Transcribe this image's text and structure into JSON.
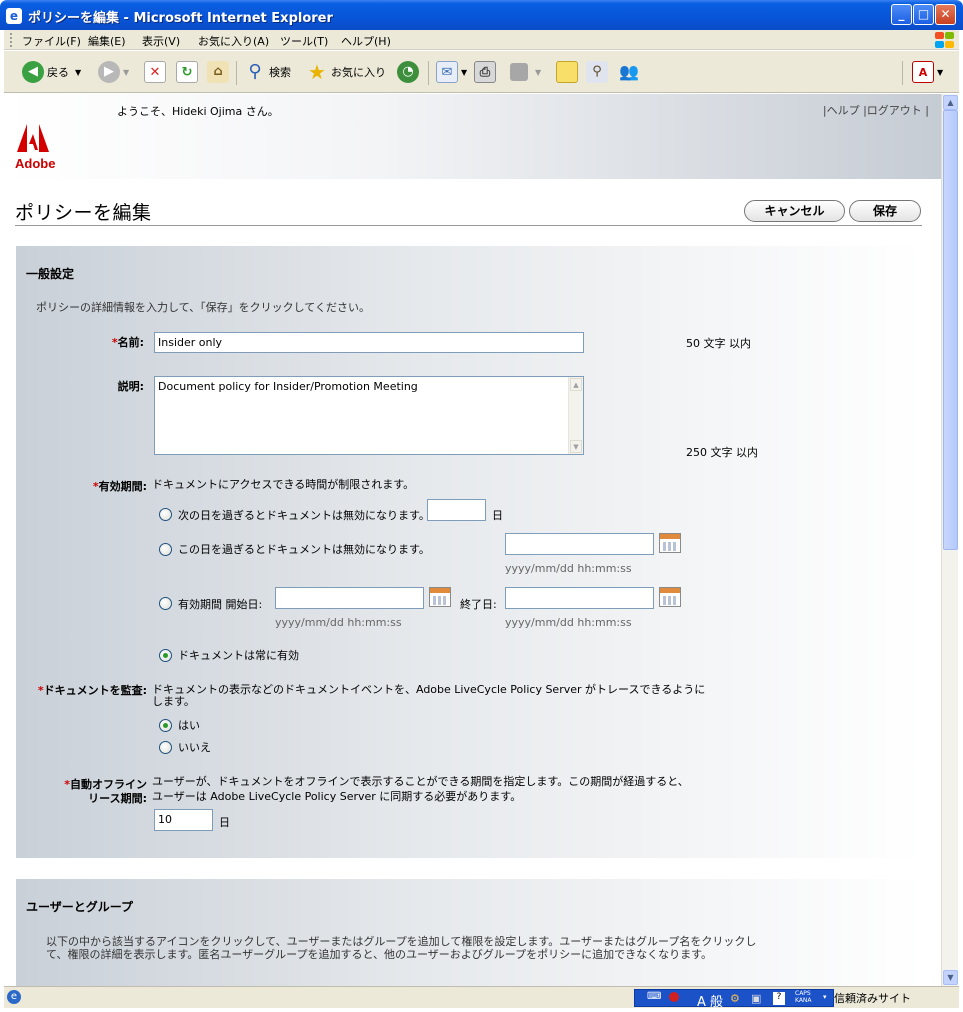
{
  "window": {
    "title": "ポリシーを編集 - Microsoft Internet Explorer",
    "ie_icon": "e",
    "min": "_",
    "max": "□",
    "close": "✕"
  },
  "menu": [
    "ファイル(F)",
    "編集(E)",
    "表示(V)",
    "お気に入り(A)",
    "ツール(T)",
    "ヘルプ(H)"
  ],
  "toolbar": {
    "back": "戻る",
    "search": "検索",
    "favorites": "お気に入り"
  },
  "statusbar": {
    "ime": "A 般",
    "caps": "CAPS",
    "kana": "KANA",
    "zone": "信頼済みサイト"
  },
  "page": {
    "welcome": "ようこそ、Hideki Ojima さん。",
    "links": {
      "help": "ヘルプ",
      "logout": "ログアウト"
    },
    "logo": "Adobe",
    "title": "ポリシーを編集",
    "cancel": "キャンセル",
    "save": "保存",
    "general": {
      "heading": "一般設定",
      "description": "ポリシーの詳細情報を入力して、「保存」をクリックしてください。",
      "name_label": "名前:",
      "name_value": "Insider only",
      "name_limit": "50 文字 以内",
      "desc_label": "説明:",
      "desc_value": "Document policy for Insider/Promotion Meeting",
      "desc_limit": "250 文字 以内",
      "validity_label": "有効期間:",
      "validity_text": "ドキュメントにアクセスできる時間が制限されます。",
      "opt_days": "次の日を過ぎるとドキュメントは無効になります。",
      "days_unit": "日",
      "opt_date": "この日を過ぎるとドキュメントは無効になります。",
      "date_format": "yyyy/mm/dd hh:mm:ss",
      "opt_range": "有効期間 開始日:",
      "end_label": "終了日:",
      "opt_always": "ドキュメントは常に有効",
      "audit_label": "ドキュメントを監査:",
      "audit_text_1": "ドキュメントの表示などのドキュメントイベントを、Adobe LiveCycle Policy Server がトレースできるように",
      "audit_text_2": "します。",
      "audit_yes": "はい",
      "audit_no": "いいえ",
      "offline_label_1": "自動オフライン",
      "offline_label_2": "リース期間:",
      "offline_text_1": "ユーザーが、ドキュメントをオフラインで表示することができる期間を指定します。この期間が経過すると、",
      "offline_text_2": "ユーザーは Adobe LiveCycle Policy Server に同期する必要があります。",
      "offline_value": "10",
      "offline_unit": "日"
    },
    "users": {
      "heading": "ユーザーとグループ",
      "description_1": "以下の中から該当するアイコンをクリックして、ユーザーまたはグループを追加して権限を設定します。ユーザーまたはグループ名をクリックし",
      "description_2": "て、権限の詳細を表示します。匿名ユーザーグループを追加すると、他のユーザーおよびグループをポリシーに追加できなくなります。"
    }
  }
}
